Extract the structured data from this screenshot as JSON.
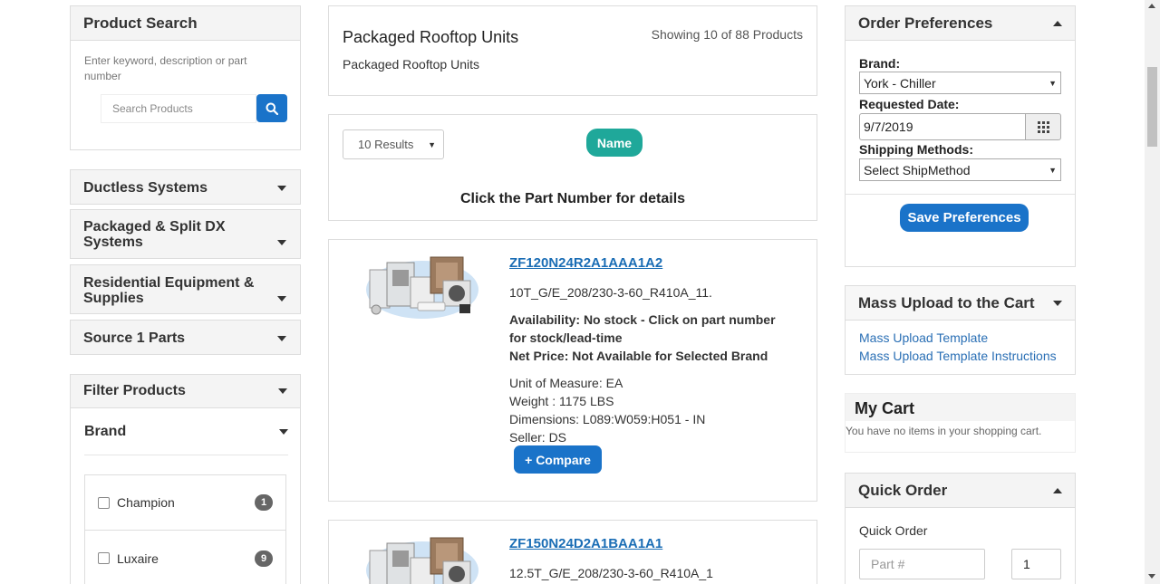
{
  "product_search": {
    "title": "Product Search",
    "hint": "Enter keyword, description or part number",
    "placeholder": "Search Products"
  },
  "categories": [
    {
      "label": "Ductless Systems"
    },
    {
      "label": "Packaged & Split DX Systems"
    },
    {
      "label": "Residential Equipment & Supplies"
    },
    {
      "label": "Source 1 Parts"
    }
  ],
  "filter": {
    "title": "Filter Products",
    "brand_title": "Brand",
    "brands": [
      {
        "label": "Champion",
        "count": "1"
      },
      {
        "label": "Luxaire",
        "count": "9"
      }
    ]
  },
  "category_header": {
    "title": "Packaged Rooftop Units",
    "subtitle": "Packaged Rooftop Units",
    "showing": "Showing 10 of 88 Products"
  },
  "sort_bar": {
    "results_select": "10 Results",
    "sort_pill": "Name",
    "instruction": "Click the Part Number for details"
  },
  "products": [
    {
      "part_number": "ZF120N24R2A1AAA1A2",
      "description": "10T_G/E_208/230-3-60_R410A_11.",
      "availability": "Availability: No stock - Click on part number for stock/lead-time",
      "net_price": "Net Price: Not Available for Selected Brand",
      "uom": "Unit of Measure: EA",
      "weight": "Weight : 1175 LBS",
      "dimensions": "Dimensions: L089:W059:H051 - IN",
      "seller": "Seller: DS",
      "compare_label": "+ Compare"
    },
    {
      "part_number": "ZF150N24D2A1BAA1A1",
      "description": "12.5T_G/E_208/230-3-60_R410A_1"
    }
  ],
  "order_prefs": {
    "title": "Order Preferences",
    "brand_label": "Brand:",
    "brand_value": "York - Chiller",
    "date_label": "Requested Date:",
    "date_value": "9/7/2019",
    "ship_label": "Shipping Methods:",
    "ship_value": "Select ShipMethod",
    "save_label": "Save Preferences"
  },
  "mass_upload": {
    "title": "Mass Upload to the Cart",
    "links": [
      "Mass Upload Template",
      "Mass Upload Template Instructions"
    ]
  },
  "cart": {
    "title": "My Cart",
    "empty_text": "You have no items in your shopping cart."
  },
  "quick_order": {
    "title": "Quick Order",
    "label": "Quick Order",
    "part_placeholder": "Part #",
    "qty_value": "1"
  },
  "colors": {
    "primary_blue": "#1a73c9",
    "teal": "#1fa89a",
    "link_blue": "#2a6fb5"
  }
}
